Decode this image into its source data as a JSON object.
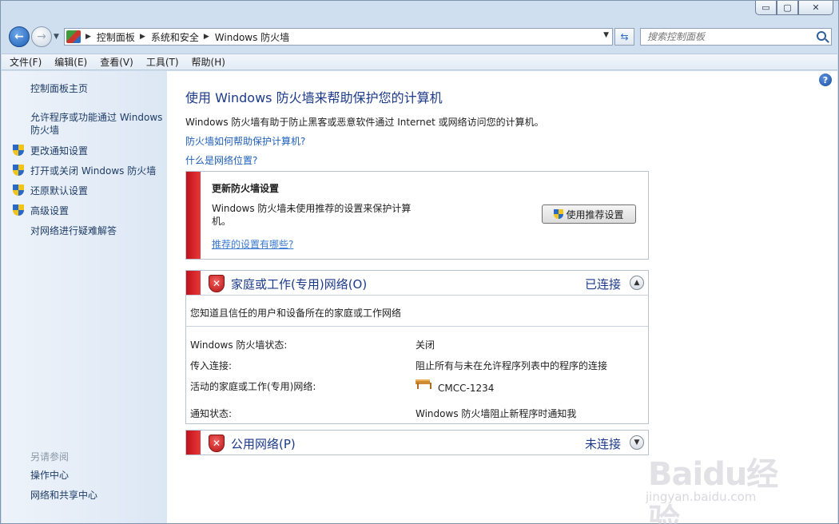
{
  "window": {
    "controls": {
      "minimize": "▭",
      "maximize": "▢",
      "close": "✕"
    }
  },
  "nav": {
    "breadcrumbs": [
      "控制面板",
      "系统和安全",
      "Windows 防火墙"
    ],
    "search_placeholder": "搜索控制面板"
  },
  "menu": [
    "文件(F)",
    "编辑(E)",
    "查看(V)",
    "工具(T)",
    "帮助(H)"
  ],
  "sidebar": {
    "home": "控制面板主页",
    "allow_program": "允许程序或功能通过 Windows 防火墙",
    "items": [
      "更改通知设置",
      "打开或关闭 Windows 防火墙",
      "还原默认设置",
      "高级设置"
    ],
    "troubleshoot": "对网络进行疑难解答",
    "see_also_label": "另请参阅",
    "see_also": [
      "操作中心",
      "网络和共享中心"
    ]
  },
  "main": {
    "title": "使用 Windows 防火墙来帮助保护您的计算机",
    "intro": "Windows 防火墙有助于防止黑客或恶意软件通过 Internet 或网络访问您的计算机。",
    "link_how": "防火墙如何帮助保护计算机?",
    "link_location": "什么是网络位置?",
    "update": {
      "title": "更新防火墙设置",
      "desc": "Windows 防火墙未使用推荐的设置来保护计算机。",
      "link": "推荐的设置有哪些?",
      "button": "使用推荐设置"
    },
    "home_network": {
      "title": "家庭或工作(专用)网络(O)",
      "status": "已连接",
      "desc": "您知道且信任的用户和设备所在的家庭或工作网络",
      "rows": [
        {
          "label": "Windows 防火墙状态:",
          "value": "关闭"
        },
        {
          "label": "传入连接:",
          "value": "阻止所有与未在允许程序列表中的程序的连接"
        },
        {
          "label": "活动的家庭或工作(专用)网络:",
          "value": "CMCC-1234"
        },
        {
          "label": "通知状态:",
          "value": "Windows 防火墙阻止新程序时通知我"
        }
      ]
    },
    "public_network": {
      "title": "公用网络(P)",
      "status": "未连接"
    }
  },
  "watermark": {
    "logo": "Baidu经验",
    "url": "jingyan.baidu.com"
  },
  "colors": {
    "accent_red": "#c0101c",
    "title_blue": "#1c3a8a",
    "link_blue": "#1f5fb8"
  }
}
